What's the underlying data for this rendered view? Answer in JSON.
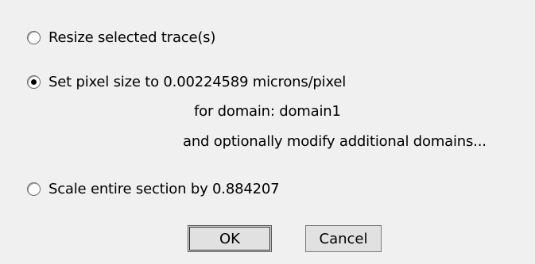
{
  "options": {
    "resize": {
      "label": "Resize selected trace(s)",
      "selected": false
    },
    "set_pixel_size": {
      "label": "Set pixel size to 0.00224589 microns/pixel",
      "line2": "for domain: domain1",
      "line3": "and optionally modify additional domains...",
      "selected": true
    },
    "scale_section": {
      "label": "Scale entire section by 0.884207",
      "selected": false
    }
  },
  "buttons": {
    "ok_label": "OK",
    "cancel_label": "Cancel"
  }
}
